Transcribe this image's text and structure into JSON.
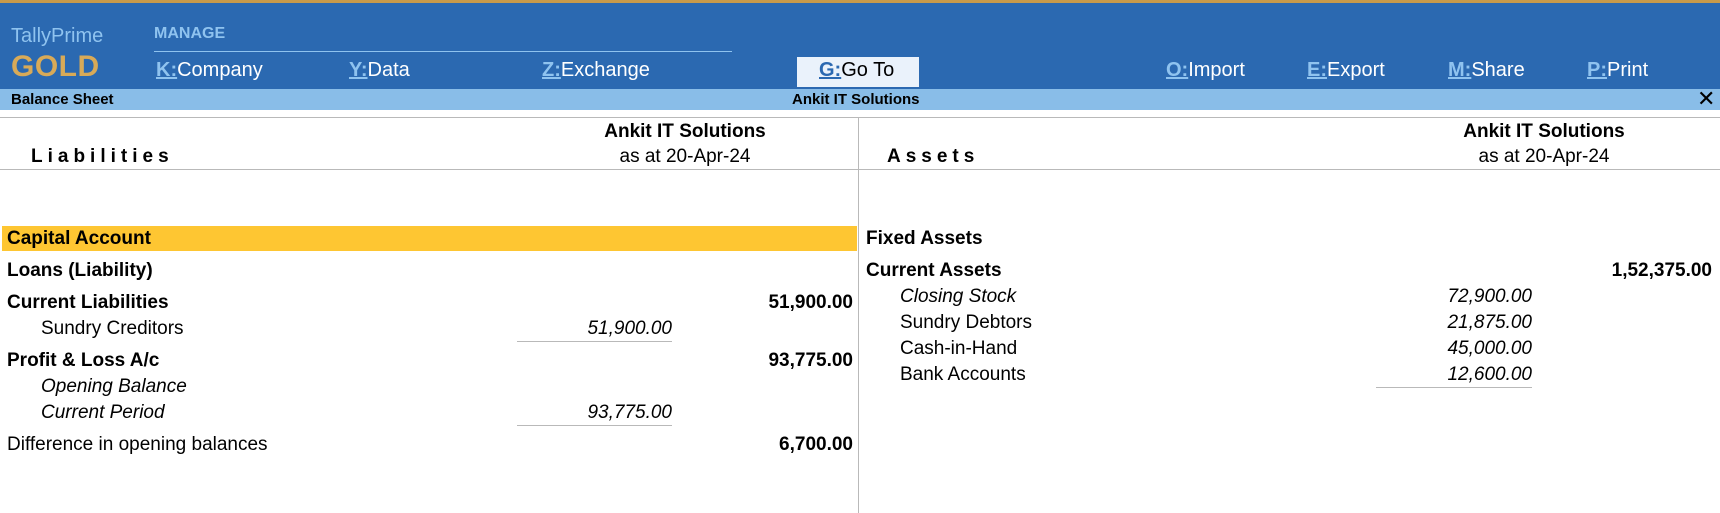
{
  "brand": {
    "name": "TallyPrime",
    "edition": "GOLD"
  },
  "menu": {
    "section": "MANAGE",
    "items": [
      {
        "key": "K:",
        "label": "Company"
      },
      {
        "key": "Y:",
        "label": "Data"
      },
      {
        "key": "Z:",
        "label": "Exchange"
      },
      {
        "key": "G:",
        "label": "Go To"
      },
      {
        "key": "O:",
        "label": "Import"
      },
      {
        "key": "E:",
        "label": "Export"
      },
      {
        "key": "M:",
        "label": "Share"
      },
      {
        "key": "P:",
        "label": "Print"
      }
    ]
  },
  "titlebar": {
    "report": "Balance Sheet",
    "company": "Ankit IT Solutions",
    "close": "✕"
  },
  "liabilities": {
    "title": "Liabilities",
    "company": "Ankit IT Solutions",
    "date": "as at 20-Apr-24",
    "rows": [
      {
        "label": "Capital Account",
        "amount": ""
      },
      {
        "label": "Loans (Liability)",
        "amount": ""
      },
      {
        "label": "Current Liabilities",
        "amount": "51,900.00"
      },
      {
        "label": "Sundry Creditors",
        "amount": "51,900.00"
      },
      {
        "label": "Profit & Loss A/c",
        "amount": "93,775.00"
      },
      {
        "label": "Opening Balance",
        "amount": ""
      },
      {
        "label": "Current Period",
        "amount": "93,775.00"
      },
      {
        "label": "Difference in opening balances",
        "amount": "6,700.00"
      }
    ]
  },
  "assets": {
    "title": "Assets",
    "company": "Ankit IT Solutions",
    "date": "as at 20-Apr-24",
    "rows": [
      {
        "label": "Fixed Assets",
        "amount": ""
      },
      {
        "label": "Current Assets",
        "amount": "1,52,375.00"
      },
      {
        "label": "Closing Stock",
        "amount": "72,900.00"
      },
      {
        "label": "Sundry Debtors",
        "amount": "21,875.00"
      },
      {
        "label": "Cash-in-Hand",
        "amount": "45,000.00"
      },
      {
        "label": "Bank Accounts",
        "amount": "12,600.00"
      }
    ]
  },
  "colors": {
    "topbar": "#2b69b1",
    "titlebar": "#89bde8",
    "highlight": "#fec632",
    "gold": "#d8aa58"
  }
}
